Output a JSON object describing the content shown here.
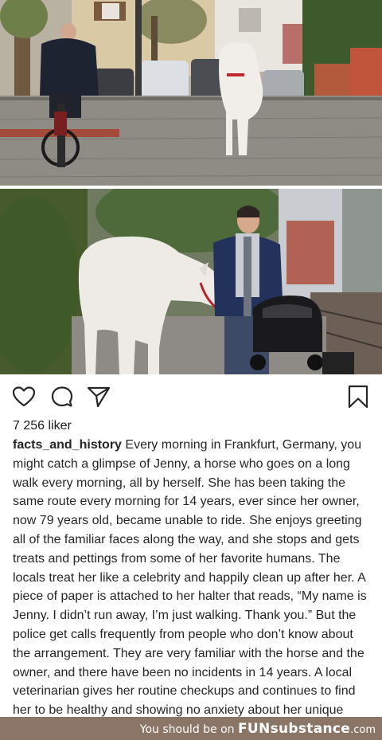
{
  "post": {
    "likes": "7 256 liker",
    "username": "facts_and_history",
    "caption": "Every morning in Frankfurt, Germany, you might catch a glimpse of Jenny, a horse who goes on a long walk every morning, all by herself. She has been taking the same route every morning for 14 years, ever since her owner, now 79 years old, became unable to ride. She enjoys greeting all of the familiar faces along the way, and she stops and gets treats and pettings from some of her favorite humans. The locals treat her like a celebrity and happily clean up after her. A piece of paper is attached to her halter that reads, “My name is Jenny. I didn’t run away, I’m just walking. Thank you.” But the police get calls frequently from people who don’t know about the arrangement. They are very familiar with the horse and the owner, and there have been no incidents in 14 years. A local veterinarian gives her routine checkups and continues to find her to be healthy and showing no anxiety about her unique lifestyle. ."
  },
  "icons": {
    "like": "heart-outline",
    "comment": "speech-bubble",
    "share": "paper-plane",
    "save": "bookmark-outline"
  },
  "footer": {
    "prefix": "You should be on",
    "brand_a": "FUN",
    "brand_b": "substance",
    "brand_c": ".com"
  },
  "colors": {
    "footer_bg": "#8a7566",
    "text": "#262626"
  }
}
